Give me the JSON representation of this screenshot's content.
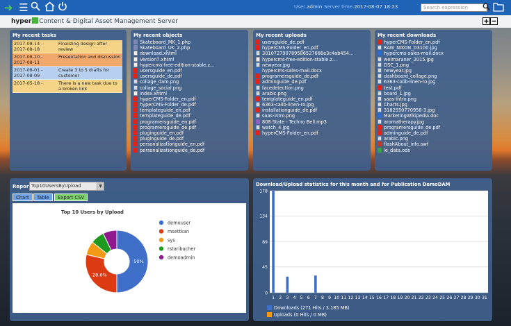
{
  "topbar": {
    "user_label": "User",
    "user_value": "admin",
    "time_label": "Server time",
    "time_value": "2017-08-07 18:23",
    "search_placeholder": "Search expression"
  },
  "brand": {
    "name": "hyper",
    "subtitle": "Content & Digital Asset Management Server"
  },
  "tasks": {
    "title": "My recent tasks",
    "rows": [
      {
        "dates": "2017-08-14 -\n2017-08-18",
        "text": "Finalizing design after review",
        "color": "yellow"
      },
      {
        "dates": "2017-08-10 -\n2017-08-11",
        "text": "Presentation and discussion",
        "color": "orange"
      },
      {
        "dates": "2017-08-01 -\n2017-08-09",
        "text": "Create 3 to 5 drafts for customer",
        "color": "blue"
      },
      {
        "dates": "2017-05-18 -",
        "text": "There is a new task due to a broken link",
        "color": "yellow"
      }
    ]
  },
  "objects": {
    "title": "My recent objects",
    "items": [
      {
        "label": "Skateboard_MK_1.php",
        "icon": "php"
      },
      {
        "label": "Skateboard_UK_2.php",
        "icon": "php"
      },
      {
        "label": "download.xhtml",
        "icon": "htm"
      },
      {
        "label": "Version7.xhtml",
        "icon": "htm"
      },
      {
        "label": "hypercms-free-edition-stable.z...",
        "icon": "htm"
      },
      {
        "label": "usersguide_en.pdf",
        "icon": "pdf"
      },
      {
        "label": "usersguide_de.pdf",
        "icon": "pdf"
      },
      {
        "label": "collage_dam.png",
        "icon": "img"
      },
      {
        "label": "collage_social.png",
        "icon": "img"
      },
      {
        "label": "index.xhtml",
        "icon": "htm"
      },
      {
        "label": "hyperCMS-Folder_en.pdf",
        "icon": "pdf"
      },
      {
        "label": "hyperCMS-Folder_de.pdf",
        "icon": "pdf"
      },
      {
        "label": "templateguide_en.pdf",
        "icon": "pdf"
      },
      {
        "label": "templateguide_de.pdf",
        "icon": "pdf"
      },
      {
        "label": "programersguide_en.pdf",
        "icon": "pdf"
      },
      {
        "label": "programersguide_de.pdf",
        "icon": "pdf"
      },
      {
        "label": "pluginguide_en.pdf",
        "icon": "pdf"
      },
      {
        "label": "pluginguide_de.pdf",
        "icon": "pdf"
      },
      {
        "label": "personalizationguide_en.pdf",
        "icon": "pdf"
      },
      {
        "label": "personalizationguide_de.pdf",
        "icon": "pdf"
      }
    ]
  },
  "uploads": {
    "title": "My recent uploads",
    "items": [
      {
        "label": "usersguide_de.pdf",
        "icon": "pdf"
      },
      {
        "label": "hyperCMS-Folder_en.pdf",
        "icon": "pdf"
      },
      {
        "label": "301072790789586527666e3c4ab454...",
        "icon": "img"
      },
      {
        "label": "hypercms-free-edition-stable.z...",
        "icon": "htm"
      },
      {
        "label": "newyear.jpg",
        "icon": "img"
      },
      {
        "label": "hypercms-sales-mail.docx",
        "icon": "doc"
      },
      {
        "label": "programersguide_de.pdf",
        "icon": "pdf"
      },
      {
        "label": "adminguide_de.pdf",
        "icon": "pdf"
      },
      {
        "label": "facedetection.png",
        "icon": "img"
      },
      {
        "label": "arabic.png",
        "icon": "img"
      },
      {
        "label": "templateguide_en.pdf",
        "icon": "pdf"
      },
      {
        "label": "6363-calib-linen-ro.jpg",
        "icon": "img"
      },
      {
        "label": "installationguide_de.pdf",
        "icon": "pdf"
      },
      {
        "label": "saas-intro.png",
        "icon": "img"
      },
      {
        "label": "808 State - Techno Bell.mp3",
        "icon": "snd"
      },
      {
        "label": "watch_4.jpg",
        "icon": "img"
      },
      {
        "label": "hyperCMS-Folder_en.pdf",
        "icon": "pdf"
      }
    ]
  },
  "downloads": {
    "title": "My recent downloads",
    "items": [
      {
        "label": "hyperCMS-Folder_en.pdf",
        "icon": "pdf"
      },
      {
        "label": "RAW_NIKON_D3100.jpg",
        "icon": "img"
      },
      {
        "label": "hypercms-sales-mail.docx",
        "icon": "doc"
      },
      {
        "label": "weimaraner_2015.jpg",
        "icon": "img"
      },
      {
        "label": "DSC_1.png",
        "icon": "img"
      },
      {
        "label": "newyear.jpg",
        "icon": "img"
      },
      {
        "label": "dashboard_collage.png",
        "icon": "img"
      },
      {
        "label": "6363-calib-linen-ro.jpg",
        "icon": "img"
      },
      {
        "label": "test.pdf",
        "icon": "pdf"
      },
      {
        "label": "board_1.jpg",
        "icon": "img"
      },
      {
        "label": "saas-intro.png",
        "icon": "img"
      },
      {
        "label": "Charts.jpg",
        "icon": "img"
      },
      {
        "label": "3182550770958-3.jpg",
        "icon": "img"
      },
      {
        "label": "MarketingWikipedia.doc",
        "icon": "doc"
      },
      {
        "label": "aromatherapy.jpg",
        "icon": "img"
      },
      {
        "label": "programersguide_de.pdf",
        "icon": "pdf"
      },
      {
        "label": "adminguide_de.pdf",
        "icon": "pdf"
      },
      {
        "label": "arabic.png",
        "icon": "img"
      },
      {
        "label": "flashAbout_info.swf",
        "icon": "swf"
      },
      {
        "label": "le_data.ods",
        "icon": "ods"
      }
    ]
  },
  "report": {
    "label": "Report",
    "selected": "Top10UsersByUpload",
    "btn_chart": "Chart",
    "btn_table": "Table",
    "btn_csv": "Export CSV"
  },
  "stats": {
    "title": "Download/Upload statistics for this month and for Publication DemoDAM",
    "legend_downloads": "Downloads (271 Hits / 3.185 MB)",
    "legend_uploads": "Uploads (0 Hits / 0 MB)"
  },
  "chart_data": [
    {
      "type": "pie",
      "title": "Top 10 Users by Upload",
      "labels": [
        "demouser",
        "msettkan",
        "sys",
        "rstaribacher",
        "demoadmin"
      ],
      "values": [
        50,
        28.6,
        7.1,
        7.1,
        7.2
      ],
      "colors": [
        "#3f6fc8",
        "#dc3a12",
        "#f29a13",
        "#1e9a1e",
        "#8e1a8e"
      ],
      "shown_labels": [
        "50%",
        "28.6%",
        "",
        "",
        ""
      ]
    },
    {
      "type": "bar",
      "title": "",
      "categories": [
        "1",
        "2",
        "3",
        "4",
        "5",
        "6",
        "7",
        "8",
        "9",
        "10",
        "11",
        "12",
        "13",
        "14",
        "15",
        "16",
        "17",
        "18",
        "19",
        "20",
        "21",
        "22",
        "23",
        "24",
        "25",
        "26",
        "27",
        "28",
        "29",
        "30",
        "31"
      ],
      "series": [
        {
          "name": "Downloads (271 Hits / 3.185 MB)",
          "values": [
            178,
            0,
            28,
            0,
            0,
            0,
            30,
            0,
            0,
            0,
            0,
            0,
            0,
            0,
            0,
            0,
            0,
            0,
            0,
            0,
            0,
            0,
            0,
            0,
            0,
            0,
            0,
            0,
            0,
            0,
            0
          ]
        },
        {
          "name": "Uploads (0 Hits / 0 MB)",
          "values": [
            0,
            0,
            0,
            0,
            0,
            0,
            0,
            0,
            0,
            0,
            0,
            0,
            0,
            0,
            0,
            0,
            0,
            0,
            0,
            0,
            0,
            0,
            0,
            0,
            0,
            0,
            0,
            0,
            0,
            0,
            0
          ]
        }
      ],
      "yticks": [
        0,
        45,
        89,
        134,
        178
      ],
      "ylim": [
        0,
        178
      ],
      "series_colors": [
        "#3f6fc8",
        "#f29a13"
      ]
    }
  ]
}
